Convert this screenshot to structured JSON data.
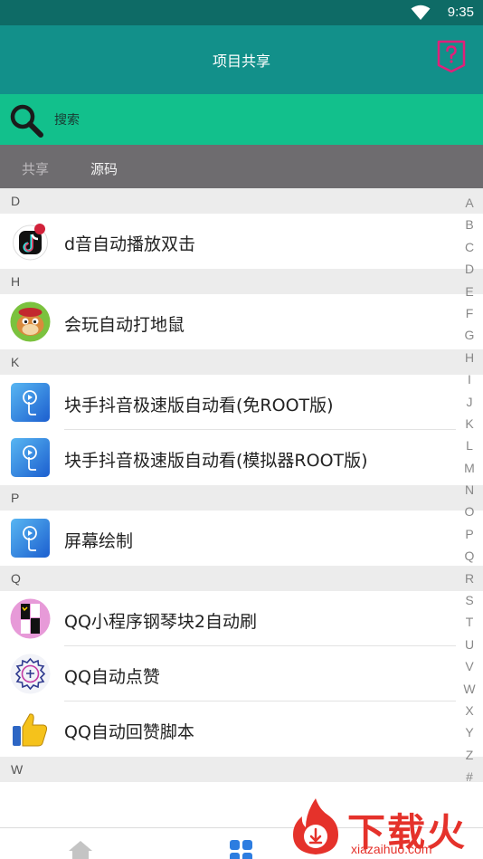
{
  "status_bar": {
    "time": "9:35"
  },
  "header": {
    "title": "项目共享"
  },
  "search": {
    "placeholder": "搜索"
  },
  "tabs": [
    {
      "label": "共享",
      "active": true
    },
    {
      "label": "源码",
      "active": false
    }
  ],
  "sections": [
    {
      "letter": "D",
      "items": [
        {
          "label": "d音自动播放双击",
          "icon": "tiktok-logo-icon"
        }
      ]
    },
    {
      "letter": "H",
      "items": [
        {
          "label": "会玩自动打地鼠",
          "icon": "cartoon-mole-icon"
        }
      ]
    },
    {
      "letter": "K",
      "items": [
        {
          "label": "块手抖音极速版自动看(免ROOT版)",
          "icon": "script-app-icon"
        },
        {
          "label": "块手抖音极速版自动看(模拟器ROOT版)",
          "icon": "script-app-icon"
        }
      ]
    },
    {
      "letter": "P",
      "items": [
        {
          "label": "屏幕绘制",
          "icon": "script-app-icon"
        }
      ]
    },
    {
      "letter": "Q",
      "items": [
        {
          "label": "QQ小程序钢琴块2自动刷",
          "icon": "piano-tiles-icon"
        },
        {
          "label": "QQ自动点赞",
          "icon": "like-badge-icon"
        },
        {
          "label": "QQ自动回赞脚本",
          "icon": "thumbs-up-icon"
        }
      ]
    },
    {
      "letter": "W",
      "items": []
    }
  ],
  "alphabet_index": [
    "A",
    "B",
    "C",
    "D",
    "E",
    "F",
    "G",
    "H",
    "I",
    "J",
    "K",
    "L",
    "M",
    "N",
    "O",
    "P",
    "Q",
    "R",
    "S",
    "T",
    "U",
    "V",
    "W",
    "X",
    "Y",
    "Z",
    "#"
  ],
  "watermark": {
    "text": "下载火",
    "url": "xiazaihuo.com"
  },
  "colors": {
    "status_bar": "#0e6b66",
    "app_bar": "#12908a",
    "search_bar": "#12c08c",
    "tab_bar": "#6e6c6f",
    "watermark": "#e5322b"
  }
}
